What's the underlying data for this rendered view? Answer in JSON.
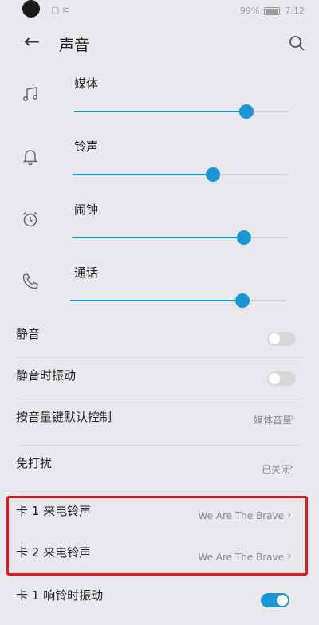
{
  "status": {
    "battery": "99%",
    "time": "7:12"
  },
  "header": {
    "title": "声音"
  },
  "volumes": [
    {
      "label": "媒体",
      "icon": "music-note-icon",
      "level": 0.8
    },
    {
      "label": "铃声",
      "icon": "bell-icon",
      "level": 0.65
    },
    {
      "label": "闹钟",
      "icon": "alarm-clock-icon",
      "level": 0.8
    },
    {
      "label": "通话",
      "icon": "phone-icon",
      "level": 0.8
    }
  ],
  "settings": {
    "mute": {
      "label": "静音",
      "on": false
    },
    "vibrate_on_mute": {
      "label": "静音时振动",
      "on": false
    },
    "volume_key": {
      "label": "按音量键默认控制",
      "value": "媒体音量"
    },
    "dnd": {
      "label": "免打扰",
      "value": "已关闭"
    },
    "sim1_ringtone": {
      "label": "卡 1 来电铃声",
      "value": "We Are The Brave"
    },
    "sim2_ringtone": {
      "label": "卡 2 来电铃声",
      "value": "We Are The Brave"
    },
    "sim1_vibrate": {
      "label": "卡 1 响铃时振动",
      "on": true
    }
  },
  "colors": {
    "accent": "#1a96d4",
    "highlight": "#e8181b"
  }
}
